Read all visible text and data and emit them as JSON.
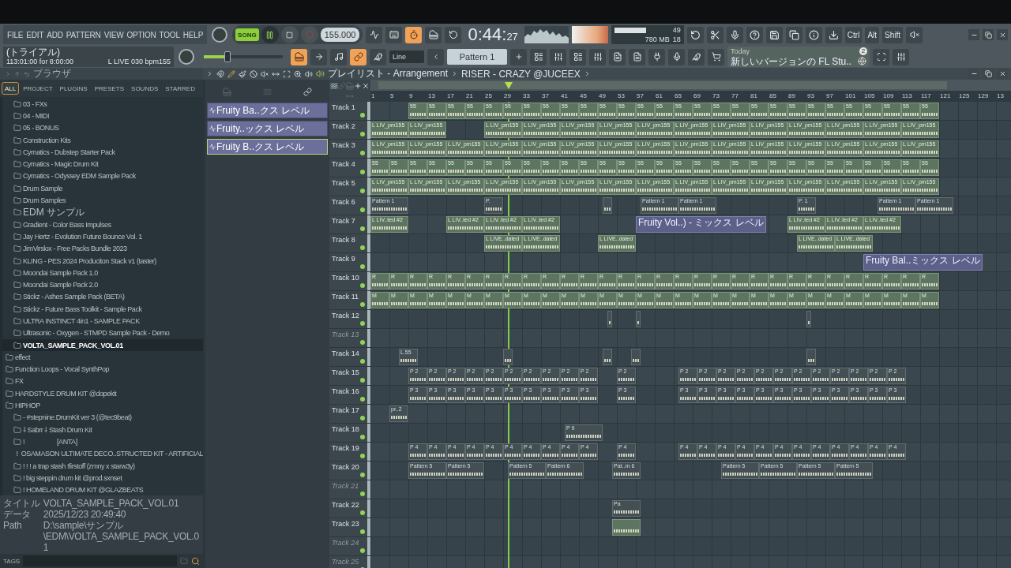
{
  "menu": [
    "FILE",
    "EDIT",
    "ADD",
    "PATTERN",
    "VIEW",
    "OPTION",
    "TOOL",
    "HELP"
  ],
  "transport": {
    "mode": "SONG",
    "song_mode": true,
    "playing": true,
    "recording": false,
    "tempo": "155.000"
  },
  "toggles_top": [
    {
      "on": false
    },
    {
      "on": false
    },
    {
      "on": true
    },
    {
      "on": false
    },
    {
      "on": false
    }
  ],
  "time": {
    "main": "0:44:",
    "small": "27"
  },
  "cpu": {
    "value": "49",
    "memory": "780 MB",
    "polyphony": "18"
  },
  "modifier_keys": [
    "Ctrl",
    "Alt",
    "Shift"
  ],
  "hint": {
    "line1": "(トライアル)",
    "line2": "113:01:00 for 8:00:00",
    "sample": "L LIVE 030 bpm155"
  },
  "master_pitch": {
    "level": 0.3
  },
  "toggles_bottom": [
    {
      "on": true
    },
    {
      "on": false
    },
    {
      "on": false
    },
    {
      "on": true
    },
    {
      "on": false
    }
  ],
  "snap": "Line",
  "pattern": "Pattern 1",
  "news": {
    "title": "Today",
    "text": "新しいバージョンの FL Stu..",
    "count": "2"
  },
  "browser": {
    "title": "ブラウザ",
    "tabs": [
      {
        "label": "ALL",
        "selected": true
      },
      {
        "label": "PROJECT",
        "selected": false
      },
      {
        "label": "PLUGINS",
        "selected": false
      },
      {
        "label": "PRESETS",
        "selected": false
      },
      {
        "label": "SOUNDS",
        "selected": false
      },
      {
        "label": "STARRED",
        "selected": false
      }
    ],
    "tree": [
      {
        "children": [
          {
            "label": "03 - FXs",
            "selected": false
          },
          {
            "label": "04 - MIDI",
            "selected": false
          },
          {
            "label": "05 - BONUS",
            "selected": false
          },
          {
            "label": "Construction Kits",
            "selected": false
          },
          {
            "label": "Cymatics - Dubstep Starter Pack",
            "selected": false
          },
          {
            "label": "Cymatics - Magic Drum Kit",
            "selected": false
          },
          {
            "label": "Cymatics - Odyssey EDM Sample Pack",
            "selected": false
          },
          {
            "label": "Drum Sample",
            "selected": false
          },
          {
            "label": "Drum Samples",
            "selected": false
          },
          {
            "label": "EDM サンプル",
            "selected": false
          },
          {
            "label": "Gradient - Color Bass Impulses",
            "selected": false
          },
          {
            "label": "Jay Hertz - Evolution Future Bounce Vol. 1",
            "selected": false
          },
          {
            "label": "JimVirslox - Free Packs Bundle 2023",
            "selected": false
          },
          {
            "label": "KLING - PES 2024 Produciton Stack v1 (taster)",
            "selected": false
          },
          {
            "label": "Moondai Sample Pack 1.0",
            "selected": false
          },
          {
            "label": "Moondai Sample Pack 2.0",
            "selected": false
          },
          {
            "label": "Stickz - Ashes Sample Pack (BETA)",
            "selected": false
          },
          {
            "label": "Stickz - Future Bass Toolkit - Sample Pack",
            "selected": false
          },
          {
            "label": "ULTRA INSTINCT 4in1 - SAMPLE PACK",
            "selected": false
          },
          {
            "label": "Ultrasonic - Oxygen - STMPD Sample Pack - Demo",
            "selected": false
          },
          {
            "label": "VOLTA_SAMPLE_PACK_VOL.01",
            "selected": true
          }
        ]
      },
      {
        "label": "effect",
        "selected": false
      },
      {
        "label": "Function Loops - Vocal SynthPop",
        "selected": false
      },
      {
        "label": "FX",
        "selected": false
      },
      {
        "label": "HARDSTYLE DRUM KIT @dopekit",
        "selected": false
      },
      {
        "label": "HIPHOP",
        "selected": false,
        "children": [
          {
            "label": "- #stepnine.DrumKit ver 3 (@tec9beat)",
            "selected": false
          },
          {
            "label": "⸸ Sabrr ⸸ Stash Drum Kit",
            "selected": false
          },
          {
            "label": "!                    [ANTA]",
            "selected": false
          },
          {
            "label": "!  OSAMASON ULTIMATE DECO..STRUCTED KIT - ARTIFICIAL",
            "selected": false
          },
          {
            "label": "! ! ! a trap stash !firstoff (zmny x starw3y)",
            "selected": false
          },
          {
            "label": "! big steppin drum kit @prod.sxnset",
            "selected": false
          },
          {
            "label": "! HOMELAND DRUM KIT @GLAZBEATS",
            "selected": false
          }
        ]
      }
    ],
    "info": [
      {
        "key": "タイトル",
        "value": "VOLTA_SAMPLE_PACK_VOL.01"
      },
      {
        "key": "データ",
        "value": "2025/12/23 20:49:40"
      },
      {
        "key": "Path",
        "value": "D:\\sample\\サンプル\\EDM\\VOLTA_SAMPLE_PACK_VOL.01"
      }
    ],
    "tags_label": "TAGS"
  },
  "playlist": {
    "title": "プレイリスト - Arrangement",
    "pattern_name": "RISER - CRAZY @JUCEEX",
    "clip_sources": [
      {
        "label": "Fruity Ba..クス レベル",
        "selected": false
      },
      {
        "label": "Fruity..ックス レベル",
        "selected": false
      },
      {
        "label": "Fruity B..クス レベル",
        "selected": true
      }
    ],
    "ruler": [
      "1",
      "5",
      "9",
      "13",
      "17",
      "21",
      "25",
      "29",
      "33",
      "37",
      "41",
      "45",
      "49",
      "53",
      "57",
      "61",
      "65",
      "69",
      "73",
      "77",
      "81",
      "85",
      "89",
      "93",
      "97",
      "101",
      "105",
      "109",
      "113",
      "117",
      "121",
      "125",
      "129",
      "13"
    ],
    "tracks": [
      {
        "name": "Track 1",
        "empty": false,
        "clips": [
          {
            "kind": "audio",
            "labels": [
              "55",
              "55",
              "55",
              "55",
              "55",
              "55",
              "55",
              "55",
              "55",
              "55",
              "55",
              "55",
              "55",
              "55",
              "55",
              "55",
              "55",
              "55",
              "55",
              "55",
              "55",
              "55",
              "55",
              "55",
              "55",
              "55",
              "55",
              "55"
            ]
          }
        ]
      },
      {
        "name": "Track 2",
        "empty": false,
        "clips": [
          {
            "kind": "audio",
            "labels": [
              "L LIV_pm155",
              "L LIV_pm155"
            ]
          },
          {
            "kind": "audio",
            "labels": [
              "L LIV_pm155",
              "L LIV_pm155",
              "L LIV_pm155",
              "L LIV_pm155",
              "L LIV_pm155",
              "L LIV_pm155",
              "L LIV_pm155",
              "L LIV_pm155",
              "L LIV_pm155",
              "L LIV_pm155",
              "L LIV_pm155",
              "L LIV_pm155"
            ]
          }
        ]
      },
      {
        "name": "Track 3",
        "empty": false,
        "clips": [
          {
            "kind": "audio",
            "labels": [
              "L LIV_pm155",
              "L LIV_pm155",
              "L LIV_pm155",
              "L LIV_pm155",
              "L LIV_pm155",
              "L LIV_pm155",
              "L LIV_pm155",
              "L LIV_pm155",
              "L LIV_pm155",
              "L LIV_pm155",
              "L LIV_pm155",
              "L LIV_pm155",
              "L LIV_pm155",
              "L LIV_pm155",
              "L LIV_pm155"
            ]
          }
        ]
      },
      {
        "name": "Track 4",
        "empty": false,
        "clips": [
          {
            "kind": "audio",
            "labels": [
              "55",
              "55",
              "55",
              "55",
              "55",
              "55",
              "55",
              "55",
              "55",
              "55",
              "55",
              "55",
              "55",
              "55",
              "55",
              "55",
              "55",
              "55",
              "55",
              "55",
              "55",
              "55",
              "55",
              "55",
              "55",
              "55",
              "55",
              "55",
              "55",
              "55"
            ]
          }
        ]
      },
      {
        "name": "Track 5",
        "empty": false,
        "clips": [
          {
            "kind": "audio",
            "labels": [
              "L LIV_pm155",
              "L LIV_pm155",
              "L LIV_pm155",
              "L LIV_pm155",
              "L LIV_pm155",
              "L LIV_pm155",
              "L LIV_pm155",
              "L LIV_pm155",
              "L LIV_pm155",
              "L LIV_pm155",
              "L LIV_pm155",
              "L LIV_pm155",
              "L LIV_pm155",
              "L LIV_pm155",
              "L LIV_pm155"
            ]
          }
        ]
      },
      {
        "name": "Track 6",
        "empty": false,
        "clips": [
          {
            "kind": "pattern",
            "labels": [
              "Pattern 1",
              "Pattern 1",
              "Pattern 1",
              "Pattern 1",
              "Pattern 1"
            ]
          },
          {
            "kind": "pattern",
            "labels": [
              "P.",
              "P. 1"
            ]
          },
          {
            "kind": "pattern"
          }
        ]
      },
      {
        "name": "Track 7",
        "empty": false,
        "clips": [
          {
            "kind": "audio",
            "labels": [
              "L LIV..ted #2",
              "L LIV..ted #2",
              "L LIV..ted #2",
              "L LIV..ted #2",
              "L LIV..ted #2",
              "L LIV..ted #2",
              "L LIV..ted #2"
            ]
          },
          {
            "kind": "automation",
            "labels": [
              "Fruity Vol..) - ミックス レベル"
            ]
          }
        ]
      },
      {
        "name": "Track 8",
        "empty": false,
        "clips": [
          {
            "kind": "audio",
            "labels": [
              "L LIVE..dated",
              "L LIVE..dated",
              "L LIVE..dated",
              "L LIVE..dated",
              "L LIVE..dated"
            ]
          }
        ]
      },
      {
        "name": "Track 9",
        "empty": false,
        "clips": [
          {
            "kind": "automation",
            "labels": [
              "Fruity Bal..ミックス レベル"
            ]
          }
        ]
      },
      {
        "name": "Track 10",
        "empty": false,
        "clips": [
          {
            "kind": "audio",
            "labels": [
              "R",
              "R",
              "R",
              "R",
              "R",
              "R",
              "R",
              "R",
              "R",
              "R",
              "R",
              "R",
              "R",
              "R",
              "R",
              "R",
              "R",
              "R",
              "R",
              "R",
              "R",
              "R",
              "R",
              "R",
              "R",
              "R",
              "R",
              "R",
              "R",
              "R"
            ]
          }
        ]
      },
      {
        "name": "Track 11",
        "empty": false,
        "clips": [
          {
            "kind": "audio",
            "labels": [
              "M",
              "M",
              "M",
              "M",
              "M",
              "M",
              "M",
              "M",
              "M",
              "M",
              "M",
              "M",
              "M",
              "M",
              "M",
              "M",
              "M",
              "M",
              "M",
              "M",
              "M",
              "M",
              "M",
              "M",
              "M",
              "M",
              "M",
              "M",
              "M",
              "M"
            ]
          }
        ]
      },
      {
        "name": "Track 12",
        "empty": false,
        "clips": [
          {
            "kind": "pattern"
          }
        ]
      },
      {
        "name": "Track 13",
        "empty": true
      },
      {
        "name": "Track 14",
        "empty": false,
        "clips": [
          {
            "kind": "pattern",
            "labels": [
              "L.55"
            ]
          },
          {
            "kind": "pattern"
          }
        ]
      },
      {
        "name": "Track 15",
        "empty": false,
        "clips": [
          {
            "kind": "pattern",
            "labels": [
              "P 2",
              "P 2",
              "P 2",
              "P 2",
              "P 2",
              "P 2",
              "P 2",
              "P 2",
              "P 2",
              "P 2"
            ]
          },
          {
            "kind": "pattern",
            "labels": [
              "P 2"
            ]
          },
          {
            "kind": "pattern",
            "labels": [
              "P 2",
              "P 2",
              "P 2",
              "P 2",
              "P 2",
              "P 2",
              "P 2",
              "P 2",
              "P 2",
              "P 2",
              "P 2",
              "P 2"
            ]
          }
        ]
      },
      {
        "name": "Track 16",
        "empty": false,
        "clips": [
          {
            "kind": "pattern",
            "labels": [
              "P 3",
              "P 3",
              "P 3",
              "P 3",
              "P 3",
              "P 3",
              "P 3",
              "P 3",
              "P 3",
              "P 3"
            ]
          },
          {
            "kind": "pattern",
            "labels": [
              "P 3"
            ]
          },
          {
            "kind": "pattern",
            "labels": [
              "P 3",
              "P 3",
              "P 3",
              "P 3",
              "P 3",
              "P 3",
              "P 3",
              "P 3",
              "P 3",
              "P 3",
              "P 3",
              "P 3"
            ]
          }
        ]
      },
      {
        "name": "Track 17",
        "empty": false,
        "clips": [
          {
            "kind": "pattern",
            "labels": [
              "pr..2"
            ]
          }
        ]
      },
      {
        "name": "Track 18",
        "empty": false,
        "clips": [
          {
            "kind": "pattern",
            "labels": [
              "P 9"
            ]
          }
        ]
      },
      {
        "name": "Track 19",
        "empty": false,
        "clips": [
          {
            "kind": "pattern",
            "labels": [
              "P 4",
              "P 4",
              "P 4",
              "P 4",
              "P 4",
              "P 4",
              "P 4",
              "P 4",
              "P 4",
              "P 4"
            ]
          },
          {
            "kind": "pattern",
            "labels": [
              "P 4"
            ]
          },
          {
            "kind": "pattern",
            "labels": [
              "P 4",
              "P 4",
              "P 4",
              "P 4",
              "P 4",
              "P 4",
              "P 4",
              "P 4",
              "P 4",
              "P 4",
              "P 4",
              "P 4"
            ]
          }
        ]
      },
      {
        "name": "Track 20",
        "empty": false,
        "clips": [
          {
            "kind": "pattern",
            "labels": [
              "Pattern 5",
              "Pattern 5",
              "Pattern 5",
              "Pattern 6",
              "Pattern 5",
              "Pattern 5",
              "Pattern 5",
              "Pattern 5"
            ]
          },
          {
            "kind": "pattern",
            "labels": [
              "Pat..rn 6"
            ]
          }
        ]
      },
      {
        "name": "Track 21",
        "empty": true
      },
      {
        "name": "Track 22",
        "empty": false,
        "clips": [
          {
            "kind": "pattern",
            "labels": [
              "Pa"
            ]
          }
        ]
      },
      {
        "name": "Track 23",
        "empty": false,
        "clips": [
          {
            "kind": "audio"
          }
        ]
      },
      {
        "name": "Track 24",
        "empty": true
      },
      {
        "name": "Track 25",
        "empty": true
      }
    ]
  }
}
